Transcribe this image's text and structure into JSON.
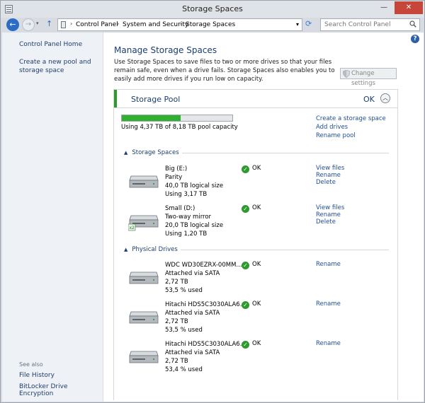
{
  "window": {
    "title": "Storage Spaces",
    "min_icon": "minimize-icon",
    "max_icon": "maximize-icon",
    "close_icon": "close-icon",
    "close_symbol": "✕",
    "min_symbol": "—",
    "max_symbol": "▭"
  },
  "address": {
    "crumbs": [
      "Control Panel",
      "System and Security",
      "Storage Spaces"
    ],
    "search_placeholder": "Search Control Panel",
    "refresh_symbol": "⟳",
    "drop_symbol": "▾"
  },
  "sidebar": {
    "home": "Control Panel Home",
    "create_pool": "Create a new pool and storage space",
    "see_also": "See also",
    "file_history": "File History",
    "bitlocker": "BitLocker Drive Encryption"
  },
  "main": {
    "title": "Manage Storage Spaces",
    "description": "Use Storage Spaces to save files to two or more drives so that your files remain safe, even when a drive fails. Storage Spaces also enables you to easily add more drives if you run low on capacity.",
    "change_settings": "Change settings",
    "help": "?"
  },
  "pool": {
    "name": "Storage Pool",
    "status": "OK",
    "used_fraction": 0.534,
    "capacity_text": "Using 4,37 TB of 8,18 TB pool capacity",
    "actions": [
      "Create a storage space",
      "Add drives",
      "Rename pool"
    ],
    "accent": "#2e9a2e"
  },
  "spaces_section": "Storage Spaces",
  "drives_section": "Physical Drives",
  "spaces": [
    {
      "name": "Big (E:)",
      "layout": "Parity",
      "logical": "40,0 TB logical size",
      "using": "Using 3,17 TB",
      "status": "OK",
      "links": [
        "View files",
        "Rename",
        "Delete"
      ]
    },
    {
      "name": "Small (D:)",
      "layout": "Two-way mirror",
      "logical": "20,0 TB logical size",
      "using": "Using 1,20 TB",
      "status": "OK",
      "links": [
        "View files",
        "Rename",
        "Delete"
      ]
    }
  ],
  "drives": [
    {
      "name": "WDC WD30EZRX-00MM...",
      "attached": "Attached via SATA",
      "size": "2,72 TB",
      "used": "53,5 % used",
      "status": "OK",
      "link": "Rename"
    },
    {
      "name": "Hitachi HDS5C3030ALA6...",
      "attached": "Attached via SATA",
      "size": "2,72 TB",
      "used": "53,5 % used",
      "status": "OK",
      "link": "Rename"
    },
    {
      "name": "Hitachi HDS5C3030ALA6...",
      "attached": "Attached via SATA",
      "size": "2,72 TB",
      "used": "53,4 % used",
      "status": "OK",
      "link": "Rename"
    }
  ]
}
